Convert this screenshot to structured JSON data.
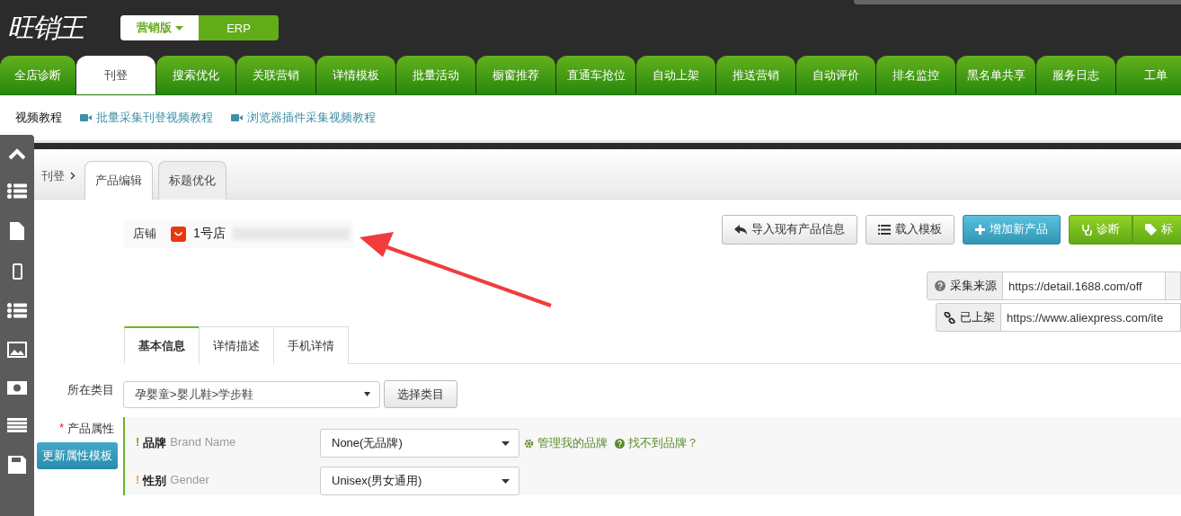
{
  "logo": {
    "text": "旺销王"
  },
  "edition_switch": [
    {
      "label": "营销版",
      "selected": true
    },
    {
      "label": "ERP",
      "selected": false
    }
  ],
  "nav_tabs": [
    {
      "label": "全店诊断",
      "selected": false
    },
    {
      "label": "刊登",
      "selected": true
    },
    {
      "label": "搜索优化",
      "selected": false
    },
    {
      "label": "关联营销",
      "selected": false
    },
    {
      "label": "详情模板",
      "selected": false
    },
    {
      "label": "批量活动",
      "selected": false
    },
    {
      "label": "橱窗推荐",
      "selected": false
    },
    {
      "label": "直通车抢位",
      "selected": false
    },
    {
      "label": "自动上架",
      "selected": false
    },
    {
      "label": "推送营销",
      "selected": false
    },
    {
      "label": "自动评价",
      "selected": false
    },
    {
      "label": "排名监控",
      "selected": false
    },
    {
      "label": "黑名单共享",
      "selected": false
    },
    {
      "label": "服务日志",
      "selected": false
    },
    {
      "label": "工单",
      "selected": false
    }
  ],
  "tutorials": {
    "title": "视频教程",
    "links": [
      "批量采集刊登视频教程",
      "浏览器插件采集视频教程"
    ]
  },
  "breadcrumb": {
    "label": "刊登"
  },
  "page_tabs": [
    {
      "label": "产品编辑",
      "selected": true
    },
    {
      "label": "标题优化",
      "selected": false
    }
  ],
  "shop": {
    "label": "店铺",
    "name": "1号店"
  },
  "actions": [
    {
      "label": "导入现有产品信息",
      "kind": "import"
    },
    {
      "label": "载入模板",
      "kind": "template"
    },
    {
      "label": "增加新产品",
      "kind": "add"
    },
    {
      "label": "诊断",
      "kind": "diagnose"
    },
    {
      "label": "标",
      "kind": "tag"
    }
  ],
  "sources": [
    {
      "label": "采集来源",
      "kind": "help",
      "value": "https://detail.1688.com/off"
    },
    {
      "label": "已上架",
      "kind": "link",
      "value": "https://www.aliexpress.com/ite"
    }
  ],
  "sub_tabs": [
    {
      "label": "基本信息",
      "selected": true
    },
    {
      "label": "详情描述",
      "selected": false
    },
    {
      "label": "手机详情",
      "selected": false
    }
  ],
  "category": {
    "label": "所在类目",
    "value": "孕婴童>婴儿鞋>学步鞋",
    "button": "选择类目"
  },
  "attributes": {
    "required_mark": "*",
    "label": "产品属性",
    "update_button": "更新属性模板",
    "links": [
      "管理我的品牌",
      "找不到品牌？"
    ],
    "rows": [
      {
        "mark": "!",
        "color": "#6aab2a",
        "name": "品牌",
        "en": "Brand Name",
        "value": "None(无品牌)"
      },
      {
        "mark": "!",
        "color": "#f0a030",
        "name": "性别",
        "en": "Gender",
        "value": "Unisex(男女通用)"
      }
    ]
  }
}
